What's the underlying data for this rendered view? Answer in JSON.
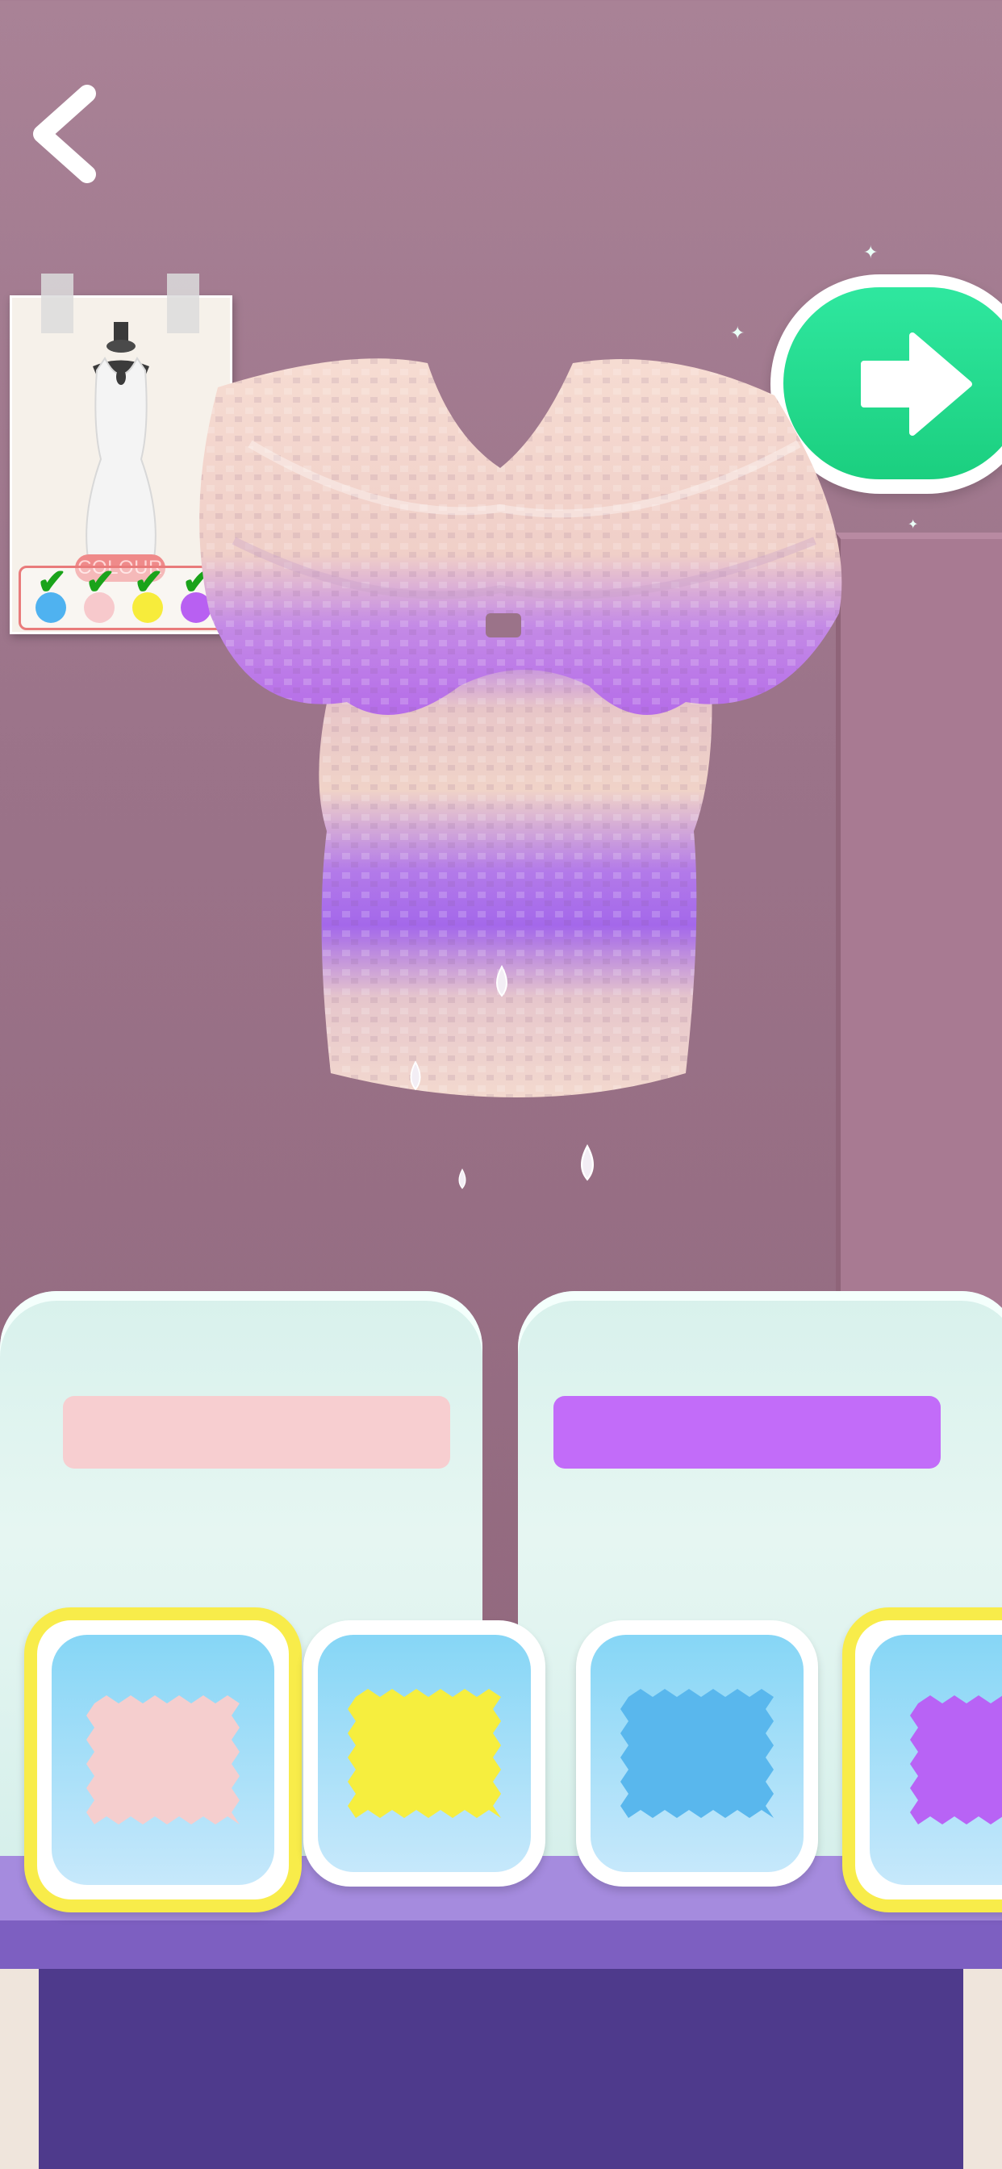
{
  "reference_card": {
    "tag_label": "COLOUR",
    "checked_colors": [
      "#4fb2f0",
      "#f7c9cc",
      "#f7ec3b",
      "#b860f2"
    ]
  },
  "swatches": [
    {
      "name": "pink",
      "color": "#f5cece",
      "selected": true
    },
    {
      "name": "yellow",
      "color": "#f6ee3e",
      "selected": false
    },
    {
      "name": "blue",
      "color": "#59b7ed",
      "selected": false
    },
    {
      "name": "purple",
      "color": "#b863f5",
      "selected": true
    }
  ],
  "tubs": [
    {
      "name": "pink",
      "color": "#f7ced0"
    },
    {
      "name": "purple",
      "color": "#c26cf9"
    }
  ],
  "icons": {
    "back": "chevron-left-icon",
    "next": "arrow-right-icon"
  }
}
